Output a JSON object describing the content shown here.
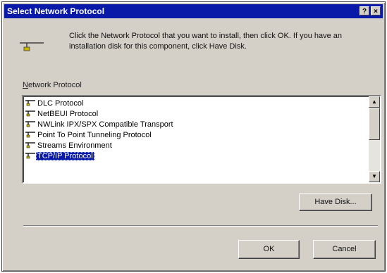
{
  "window": {
    "title": "Select Network Protocol",
    "help_glyph": "?",
    "close_glyph": "×"
  },
  "instructions": "Click the Network Protocol that you want to install, then click OK.  If you have an installation disk for this component, click Have Disk.",
  "list_label": {
    "mnemonic": "N",
    "rest": "etwork Protocol"
  },
  "protocols": [
    {
      "label": "DLC Protocol",
      "selected": false
    },
    {
      "label": "NetBEUI Protocol",
      "selected": false
    },
    {
      "label": "NWLink IPX/SPX Compatible Transport",
      "selected": false
    },
    {
      "label": "Point To Point Tunneling Protocol",
      "selected": false
    },
    {
      "label": "Streams Environment",
      "selected": false
    },
    {
      "label": "TCP/IP Protocol",
      "selected": true
    }
  ],
  "scrollbar": {
    "up_glyph": "▲",
    "down_glyph": "▼"
  },
  "buttons": {
    "have_disk": "Have Disk...",
    "ok": "OK",
    "cancel": "Cancel"
  },
  "colors": {
    "title_bar": "#0a1aa8",
    "selection": "#0a1aa8",
    "face": "#d4d0c8"
  },
  "icons": {
    "protocol": "network-protocol-icon"
  }
}
